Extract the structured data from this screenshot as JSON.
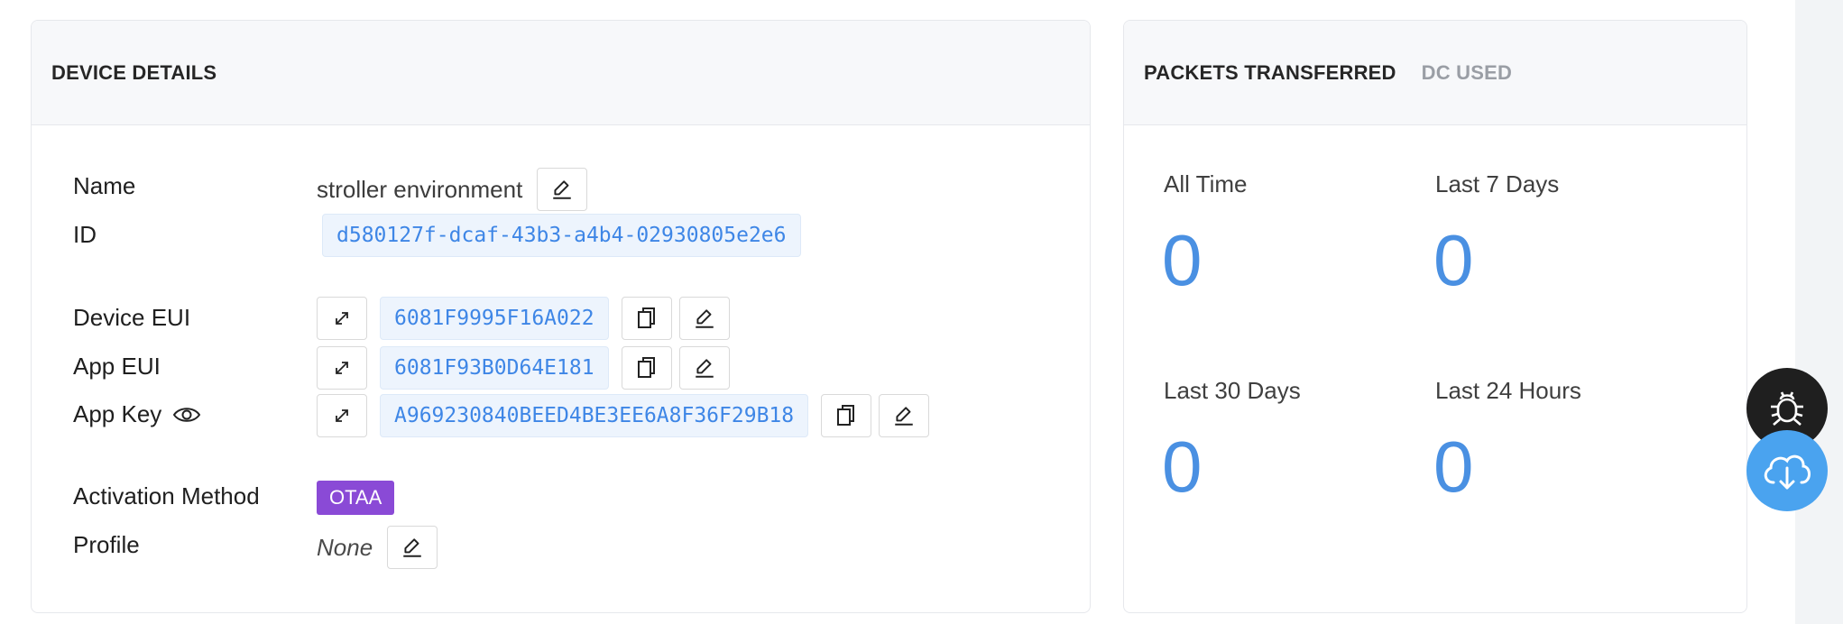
{
  "device_details": {
    "title": "DEVICE DETAILS",
    "name": {
      "label": "Name",
      "value": "stroller environment"
    },
    "id": {
      "label": "ID",
      "value": "d580127f-dcaf-43b3-a4b4-02930805e2e6"
    },
    "device_eui": {
      "label": "Device EUI",
      "value": "6081F9995F16A022"
    },
    "app_eui": {
      "label": "App EUI",
      "value": "6081F93B0D64E181"
    },
    "app_key": {
      "label": "App Key",
      "value": "A969230840BEED4BE3EE6A8F36F29B18"
    },
    "activation": {
      "label": "Activation Method",
      "value": "OTAA",
      "color": "#8a4ad6"
    },
    "profile": {
      "label": "Profile",
      "value": "None"
    }
  },
  "stats": {
    "tabs": [
      "PACKETS TRANSFERRED",
      "DC USED"
    ],
    "items": [
      {
        "label": "All Time",
        "value": "0"
      },
      {
        "label": "Last 7 Days",
        "value": "0"
      },
      {
        "label": "Last 30 Days",
        "value": "0"
      },
      {
        "label": "Last 24 Hours",
        "value": "0"
      }
    ],
    "value_color": "#4a90e2"
  },
  "fabs": {
    "debug_icon": "bug-icon",
    "download_icon": "cloud-download-icon"
  }
}
